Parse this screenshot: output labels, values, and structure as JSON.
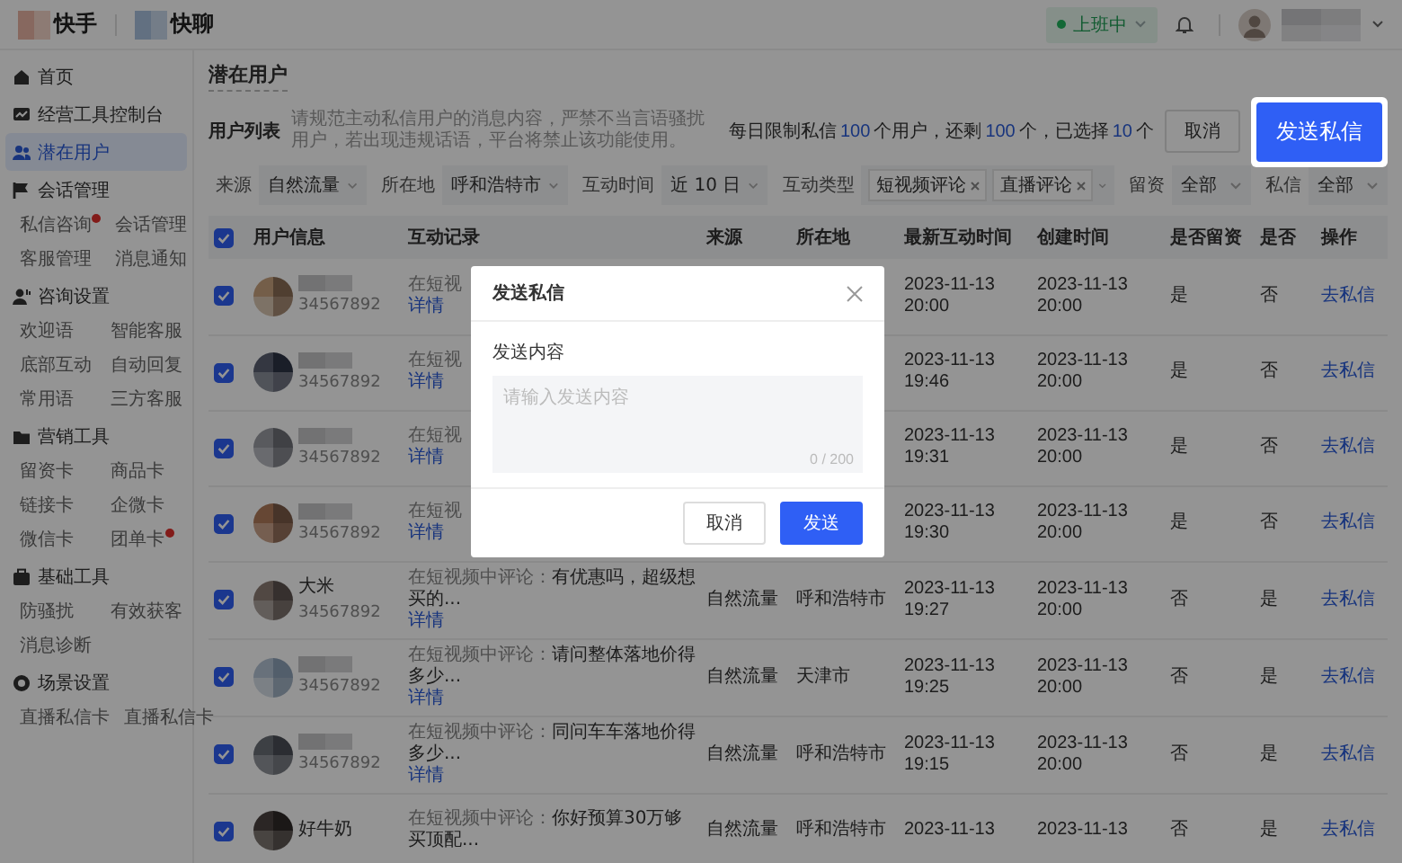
{
  "app_bar": {
    "logos": [
      {
        "label": "快手"
      },
      {
        "label": "快聊"
      }
    ],
    "status": {
      "label": "上班中"
    }
  },
  "sidebar": {
    "items": [
      {
        "label": "首页",
        "selected": false
      },
      {
        "label": "经营工具控制台",
        "selected": false
      },
      {
        "label": "潜在用户",
        "selected": true
      },
      {
        "label": "会话管理",
        "selected": false,
        "children": [
          {
            "label": "私信咨询",
            "badge": true,
            "selected": false
          },
          {
            "label": "会话管理",
            "badge": false,
            "selected": false
          },
          {
            "label": "客服管理",
            "badge": false,
            "selected": false
          },
          {
            "label": "消息通知",
            "badge": false,
            "selected": false
          }
        ]
      },
      {
        "label": "咨询设置",
        "selected": false,
        "children": [
          {
            "label": "欢迎语",
            "badge": false,
            "selected": false
          },
          {
            "label": "智能客服",
            "badge": false,
            "selected": false
          },
          {
            "label": "底部互动",
            "badge": false,
            "selected": false
          },
          {
            "label": "自动回复",
            "badge": false,
            "selected": false
          },
          {
            "label": "常用语",
            "badge": false,
            "selected": false
          },
          {
            "label": "三方客服",
            "badge": false,
            "selected": false
          }
        ]
      },
      {
        "label": "营销工具",
        "selected": false,
        "children": [
          {
            "label": "留资卡",
            "badge": false,
            "selected": false
          },
          {
            "label": "商品卡",
            "badge": false,
            "selected": false
          },
          {
            "label": "链接卡",
            "badge": false,
            "selected": false
          },
          {
            "label": "企微卡",
            "badge": false,
            "selected": false
          },
          {
            "label": "微信卡",
            "badge": false,
            "selected": false
          },
          {
            "label": "团单卡",
            "badge": true,
            "selected": false
          }
        ]
      },
      {
        "label": "基础工具",
        "selected": false,
        "children": [
          {
            "label": "防骚扰",
            "badge": false,
            "selected": false
          },
          {
            "label": "有效获客",
            "badge": false,
            "selected": false
          },
          {
            "label": "消息诊断",
            "badge": false,
            "selected": false
          }
        ]
      },
      {
        "label": "场景设置",
        "selected": false,
        "children": [
          {
            "label": "直播私信卡",
            "badge": false,
            "selected": false
          },
          {
            "label": "直播私信卡",
            "badge": false,
            "selected": false
          }
        ]
      }
    ]
  },
  "page": {
    "title": "潜在用户",
    "list_title": "用户列表",
    "notice": "请规范主动私信用户的消息内容，严禁不当言语骚扰用户，若出现违规话语，平台将禁止该功能使用。",
    "quota": [
      {
        "text": "每日限制私信",
        "highlight": false
      },
      {
        "text": "100",
        "highlight": true
      },
      {
        "text": "个用户，还剩",
        "highlight": false
      },
      {
        "text": "100",
        "highlight": true
      },
      {
        "text": "个，已选择",
        "highlight": false
      },
      {
        "text": "10",
        "highlight": true
      },
      {
        "text": "个",
        "highlight": false
      }
    ],
    "buttons": [
      {
        "label": "取消",
        "kind": "secondary",
        "highlighted": false
      },
      {
        "label": "发送私信",
        "kind": "primary",
        "highlighted": true
      }
    ]
  },
  "filters": [
    {
      "label": "来源",
      "kind": "select",
      "value": "自然流量"
    },
    {
      "label": "所在地",
      "kind": "select",
      "value": "呼和浩特市"
    },
    {
      "label": "互动时间",
      "kind": "select",
      "value": "近 10 日"
    },
    {
      "label": "互动类型",
      "kind": "tags",
      "tags": [
        "短视频评论",
        "直播评论"
      ]
    },
    {
      "label": "留资",
      "kind": "select",
      "value": "全部"
    },
    {
      "label": "私信",
      "kind": "select",
      "value": "全部"
    }
  ],
  "table": {
    "header_checked": true,
    "columns": [
      "用户信息",
      "互动记录",
      "来源",
      "所在地",
      "最新互动时间",
      "创建时间",
      "是否留资",
      "是否",
      "操作"
    ],
    "rows": [
      {
        "checked": true,
        "phone": "34567892",
        "interaction_prefix": "在短视",
        "detail_link": "详情",
        "latest": "2023-11-13 20:00",
        "created": "2023-11-13 20:00",
        "lead": "是",
        "column_8": "否",
        "action": "去私信"
      },
      {
        "checked": true,
        "phone": "34567892",
        "interaction_prefix": "在短视",
        "detail_link": "详情",
        "latest": "2023-11-13 19:46",
        "created": "2023-11-13 20:00",
        "lead": "是",
        "column_8": "否",
        "action": "去私信"
      },
      {
        "checked": true,
        "phone": "34567892",
        "interaction_prefix": "在短视",
        "detail_link": "详情",
        "latest": "2023-11-13 19:31",
        "created": "2023-11-13 20:00",
        "lead": "是",
        "column_8": "否",
        "action": "去私信"
      },
      {
        "checked": true,
        "phone": "34567892",
        "interaction_prefix": "在短视",
        "detail_link": "详情",
        "latest": "2023-11-13 19:30",
        "created": "2023-11-13 20:00",
        "lead": "是",
        "column_8": "否",
        "action": "去私信"
      },
      {
        "checked": true,
        "name": "大米",
        "phone": "34567892",
        "interaction_prefix": "在短视频中评论：",
        "interaction": "有优惠吗，超级想买的...",
        "detail_link": "详情",
        "source": "自然流量",
        "location": "呼和浩特市",
        "latest": "2023-11-13 19:27",
        "created": "2023-11-13 20:00",
        "lead": "否",
        "column_8": "是",
        "action": "去私信"
      },
      {
        "checked": true,
        "phone": "34567892",
        "interaction_prefix": "在短视频中评论：",
        "interaction": "请问整体落地价得多少...",
        "detail_link": "详情",
        "source": "自然流量",
        "location": "天津市",
        "latest": "2023-11-13 19:25",
        "created": "2023-11-13 20:00",
        "lead": "否",
        "column_8": "是",
        "action": "去私信"
      },
      {
        "checked": true,
        "phone": "34567892",
        "interaction_prefix": "在短视频中评论：",
        "interaction": "同问车车落地价得多少...",
        "detail_link": "详情",
        "source": "自然流量",
        "location": "呼和浩特市",
        "latest": "2023-11-13 19:15",
        "created": "2023-11-13 20:00",
        "lead": "否",
        "column_8": "是",
        "action": "去私信"
      },
      {
        "checked": true,
        "name": "好牛奶",
        "interaction_prefix": "在短视频中评论：",
        "interaction": "你好预算30万够买顶配...",
        "source": "自然流量",
        "location": "呼和浩特市",
        "latest": "2023-11-13",
        "created": "2023-11-13",
        "lead": "否",
        "column_8": "是",
        "action": "去私信"
      }
    ]
  },
  "modal": {
    "title": "发送私信",
    "field_label": "发送内容",
    "placeholder": "请输入发送内容",
    "counter": "0 / 200",
    "buttons": [
      {
        "label": "取消",
        "kind": "secondary"
      },
      {
        "label": "发送",
        "kind": "primary"
      }
    ]
  }
}
